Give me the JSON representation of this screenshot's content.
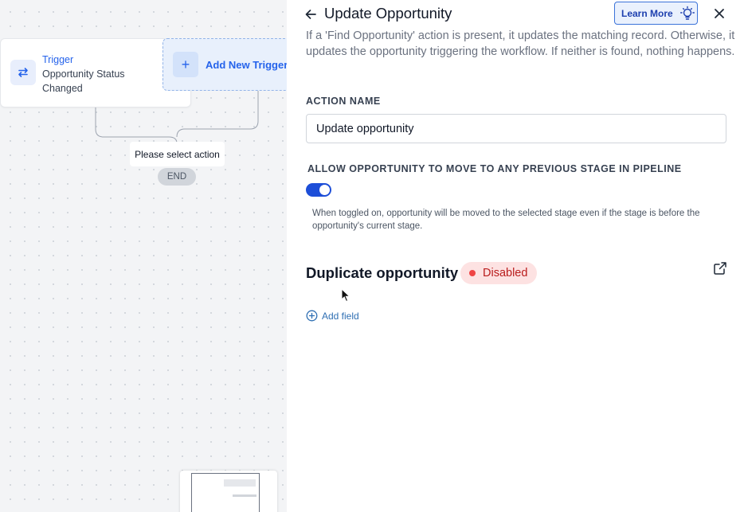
{
  "canvas": {
    "trigger": {
      "title": "Trigger",
      "subtitle": "Opportunity Status Changed",
      "icon": "arrows-swap-icon"
    },
    "add_trigger": {
      "label": "Add New Trigger",
      "icon": "plus-icon"
    },
    "select_action": "Please select action",
    "end_label": "END"
  },
  "panel": {
    "title": "Update Opportunity",
    "learn_more": "Learn More",
    "description": "If a 'Find Opportunity' action is present, it updates the matching record. Otherwise, it updates the opportunity triggering the workflow. If neither is found, nothing happens.",
    "action_name_label": "ACTION NAME",
    "action_name_value": "Update opportunity",
    "allow_label": "ALLOW OPPORTUNITY TO MOVE TO ANY PREVIOUS STAGE IN PIPELINE",
    "allow_toggle_on": true,
    "allow_help": "When toggled on, opportunity will be moved to the selected stage even if the stage is before the opportunity's current stage.",
    "duplicate_title": "Duplicate opportunity",
    "duplicate_status": "Disabled",
    "add_field": "Add field"
  },
  "colors": {
    "accent": "#2563eb",
    "toggle": "#1d4ed8",
    "disabled_bg": "#fde2e2",
    "disabled_text": "#b91c1c"
  }
}
